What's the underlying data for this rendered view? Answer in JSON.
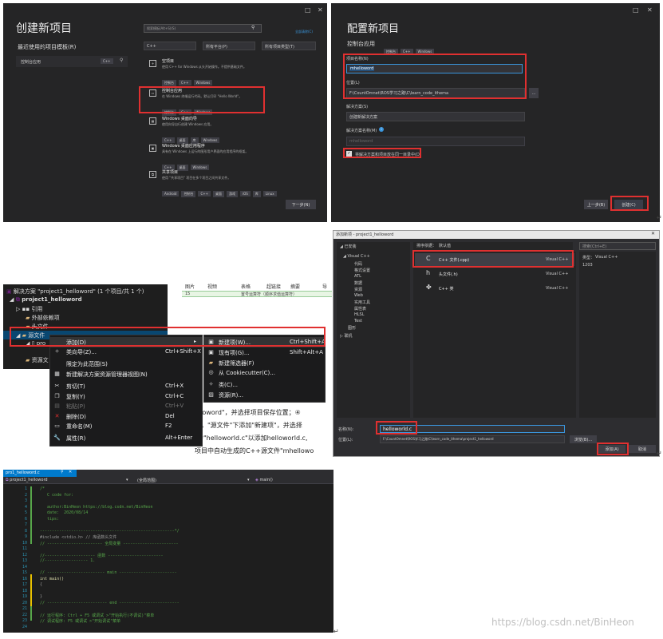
{
  "panel1": {
    "title": "创建新项目",
    "recent_header": "最近使用的项目模板(R)",
    "recent_item": "控制台应用",
    "recent_item_lang": "C++",
    "search_placeholder": "搜索模板(Alt+S)(S)",
    "clear_all": "全部清除(C)",
    "filter_language": "C++",
    "filter_platform": "所有平台(P)",
    "filter_type": "所有项目类型(T)",
    "next_button": "下一步(N)",
    "templates": [
      {
        "title": "空项目",
        "desc": "使用 C++ for Windows 从头开始操作。不提供基础文件。",
        "tags": [
          "控制台",
          "C++",
          "Windows"
        ]
      },
      {
        "title": "控制台应用",
        "desc": "在 Windows 终端运行代码。默认打印 \"Hello World\"。",
        "tags": [
          "控制台",
          "C++",
          "Windows"
        ]
      },
      {
        "title": "Windows 桌面向导",
        "desc": "使用向导自行创建 Windows 应用。",
        "tags": [
          "C++",
          "桌面",
          "库",
          "Windows"
        ]
      },
      {
        "title": "Windows 桌面应用程序",
        "desc": "具有在 Windows 上运行的图形用户界面的应用程序的框架。",
        "tags": [
          "C++",
          "桌面",
          "Windows"
        ]
      },
      {
        "title": "共享项目",
        "desc": "使用 \"共享项目\" 项目在多个项目之间共享文件。",
        "tags": [
          "Android",
          "控制台",
          "C++",
          "桌面",
          "游戏",
          "iOS",
          "库",
          "Linux"
        ]
      }
    ]
  },
  "panel2": {
    "title": "配置新项目",
    "subtitle": "控制台应用",
    "tags": [
      "控制台",
      "C++",
      "Windows"
    ],
    "project_name_label": "项目名称(N)",
    "project_name_value": "mhelloword",
    "location_label": "位置(L)",
    "location_value": "F:\\CountOmnet\\ROS学习之路\\C\\learn_code_ithema",
    "browse": "...",
    "solution_label": "解决方案(S)",
    "solution_value": "创建新解决方案",
    "solution_name_label": "解决方案名称(M)",
    "solution_name_value": "mhelloword",
    "same_dir_checkbox": "将解决方案和项目放在同一目录中(D)",
    "back_button": "上一步(B)",
    "create_button": "创建(C)"
  },
  "panel3": {
    "solution_title": "解决方案 \"project1_helloword\" (1 个项目/共 1 个)",
    "tree": [
      "project1_helloword",
      "引用",
      "外部依赖项",
      "头文件",
      "源文件",
      "pro",
      "资源文"
    ],
    "menu": [
      {
        "label": "添加(D)",
        "shortcut": "",
        "icon": ""
      },
      {
        "label": "类向导(Z)...",
        "shortcut": "Ctrl+Shift+X",
        "icon": "✧"
      },
      {
        "label": "限定为此范围(S)",
        "shortcut": "",
        "icon": ""
      },
      {
        "label": "新建解决方案资源管理器视图(N)",
        "shortcut": "",
        "icon": "▦"
      },
      {
        "label": "剪切(T)",
        "shortcut": "Ctrl+X",
        "icon": "✂"
      },
      {
        "label": "复制(Y)",
        "shortcut": "Ctrl+C",
        "icon": "❐"
      },
      {
        "label": "粘贴(P)",
        "shortcut": "Ctrl+V",
        "icon": "▤"
      },
      {
        "label": "删除(D)",
        "shortcut": "Del",
        "icon": "✕"
      },
      {
        "label": "重命名(M)",
        "shortcut": "F2",
        "icon": "▭"
      },
      {
        "label": "属性(R)",
        "shortcut": "Alt+Enter",
        "icon": "🔧"
      }
    ],
    "submenu": [
      {
        "label": "新建项(W)...",
        "shortcut": "Ctrl+Shift+A",
        "icon": "▣"
      },
      {
        "label": "现有项(G)...",
        "shortcut": "Shift+Alt+A",
        "icon": "▣"
      },
      {
        "label": "新建筛选器(F)",
        "shortcut": "",
        "icon": "▰"
      },
      {
        "label": "从 Cookiecutter(C)...",
        "shortcut": "",
        "icon": "◎"
      },
      {
        "label": "类(C)...",
        "shortcut": "",
        "icon": "✧"
      },
      {
        "label": "资源(R)...",
        "shortcut": "",
        "icon": "▨"
      }
    ],
    "bg_headers": [
      "图片",
      "视频",
      "表格",
      "超链接",
      "摘要",
      "导"
    ],
    "bg_row_num": "15",
    "bg_row_text": "置号运算符（顺序求值运算符）",
    "bg_lines": [
      "elloword\"，并选择项目保存位置；④",
      "，\"源文件\"下添加\"新建项\"，并选择",
      "为\"helloworld.c\"以添加helloworld.c,",
      "项目中自动生成的C++源文件\"mhellowo"
    ]
  },
  "panel4": {
    "title": "添加新项 - project1_helloword",
    "sort_label": "排序依据：",
    "sort_value": "默认值",
    "search_placeholder": "搜索(Ctrl+E)",
    "installed": "已安装",
    "tree": [
      "Visual C++",
      "代码",
      "格式设置",
      "ATL",
      "数据",
      "资源",
      "Web",
      "实用工具",
      "属性表",
      "HLSL",
      "Test",
      "图形",
      "联机"
    ],
    "items": [
      {
        "name": "C++ 文件(.cpp)",
        "type": "Visual C++",
        "icon": "C"
      },
      {
        "name": "头文件(.h)",
        "type": "Visual C++",
        "icon": "h"
      },
      {
        "name": "C++ 类",
        "type": "Visual C++",
        "icon": "✤"
      }
    ],
    "type_label": "类型：",
    "type_value": "Visual C++",
    "type_num": "1203",
    "name_label": "名称(N):",
    "name_value": "helloworld.c",
    "location_label": "位置(L):",
    "location_value": "F:\\CountOmnet\\ROS学习之路\\C\\learn_code_ithema\\project1_helloword",
    "browse_button": "浏览(B)...",
    "add_button": "添加(A)",
    "cancel_button": "取消"
  },
  "panel5": {
    "tab": "pro1_helloword.c",
    "project_dd": "project1_helloword",
    "scope_dd": "(全局范围)",
    "func_dd": "main()",
    "line_numbers": [
      "1",
      "2",
      "3",
      "4",
      "5",
      "6",
      "7",
      "8",
      "9",
      "10",
      "11",
      "12",
      "13",
      "14",
      "15",
      "16",
      "17",
      "18",
      "19",
      "20",
      "21",
      "22",
      "23",
      "24"
    ],
    "code": [
      "/*",
      "   C code for:",
      "",
      "   author:BinHeon https://blog.csdn.net/BinHeon",
      "   date:  2020/08/14",
      "   tips:",
      "",
      "--------------------------------------------------------*/",
      "#include <stdio.h> // 库函数头文件",
      "// ----------------------- 全局变量 -----------------------",
      "",
      "//--------------------- 函数 -----------------------",
      "//------------------ 1.",
      "",
      "// ------------------------ main ------------------------",
      "int main()",
      "{",
      "",
      "}",
      "// ------------------------- end -------------------------",
      "",
      "// 运行程序: Ctrl + F5 或调试 >\"开始执行(不调试)\"菜单",
      "// 调试程序: F5 或调试 >\"开始调试\"菜单",
      ""
    ]
  },
  "watermark": "https://blog.csdn.net/BinHeon"
}
